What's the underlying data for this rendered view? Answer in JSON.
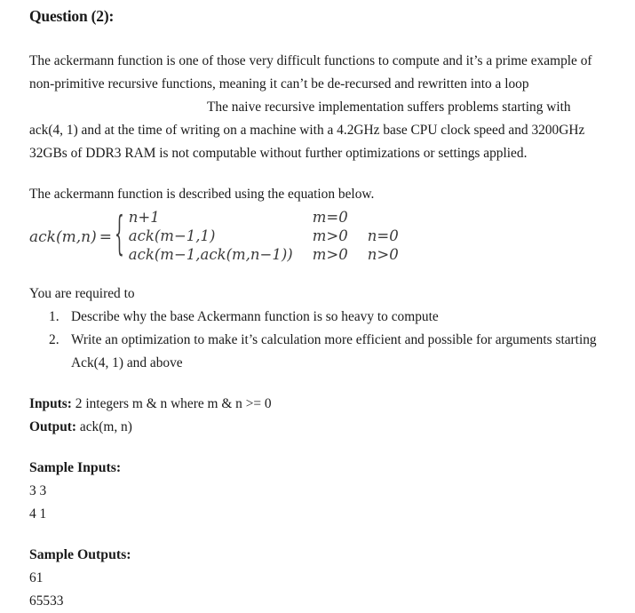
{
  "document": {
    "title": "Question (2):",
    "paragraph1": {
      "before_gap": "The ackermann function is one of those very difficult functions to compute and it’s a prime example of non-primitive recursive functions, meaning it can’t be de-recursed and rewritten into a loop",
      "after_gap": "The naive recursive implementation suffers problems starting with ack(4, 1) and at the time of writing on a machine with a 4.2GHz base CPU clock speed and 3200GHz 32GBs of DDR3 RAM is not computable without further optimizations or settings applied."
    },
    "equation_intro": "The ackermann function is described using the equation below.",
    "equation": {
      "lhs": "ack(m,n)",
      "equals": "=",
      "brace": "{",
      "cases": [
        {
          "expression": "n+1",
          "condition1": "m=0",
          "condition2": ""
        },
        {
          "expression": "ack(m−1,1)",
          "condition1": "m>0",
          "condition2": "n=0"
        },
        {
          "expression": "ack(m−1,ack(m,n−1))",
          "condition1": "m>0",
          "condition2": "n>0"
        }
      ]
    },
    "requirements": {
      "intro": "You are required to",
      "items": [
        {
          "number": "1.",
          "text": "Describe why the base Ackermann function is so heavy to compute"
        },
        {
          "number": "2.",
          "text": "Write an optimization to make it’s calculation more efficient and possible for arguments starting Ack(4, 1) and above"
        }
      ]
    },
    "io": {
      "inputs_label": "Inputs:",
      "inputs_value": "2 integers m & n where m & n >= 0",
      "output_label": "Output:",
      "output_value": "ack(m, n)"
    },
    "sample_inputs": {
      "heading": "Sample Inputs:",
      "lines": [
        "3 3",
        "4 1"
      ]
    },
    "sample_outputs": {
      "heading": "Sample Outputs:",
      "lines": [
        "61",
        "65533"
      ]
    }
  }
}
